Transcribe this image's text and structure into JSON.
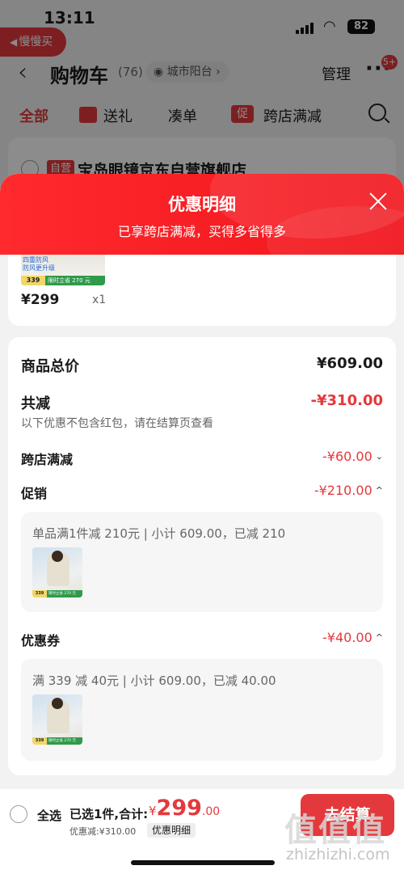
{
  "status_bar": {
    "time": "13:11",
    "battery": "82"
  },
  "back_app": {
    "label": "慢慢买"
  },
  "nav": {
    "title": "购物车",
    "count": "(76)",
    "location": "城市阳台",
    "manage": "管理",
    "more": "···",
    "badge": "5+"
  },
  "tabs": [
    {
      "label": "全部"
    },
    {
      "label": "送礼"
    },
    {
      "label": "凑单"
    },
    {
      "label": "跨店满减",
      "icon_text": "促"
    }
  ],
  "store": {
    "self_tag": "自营",
    "name": "宝岛眼镜京东自营旗舰店"
  },
  "sheet": {
    "title": "优惠明细",
    "subtitle": "已享跨店满减，买得多省得多"
  },
  "product": {
    "price": "¥299",
    "qty": "x1",
    "thumb_text1": "四重防风",
    "thumb_text2": "防风更升级",
    "thumb_price": "339",
    "thumb_tag": "限时立省 270 元"
  },
  "details": {
    "total_label": "商品总价",
    "total_value": "¥609.00",
    "reduce_label": "共减",
    "reduce_value": "-¥310.00",
    "reduce_note": "以下优惠不包含红包，请在结算页查看",
    "cross_label": "跨店满减",
    "cross_value": "-¥60.00",
    "promo_label": "促销",
    "promo_value": "-¥210.00",
    "promo_desc": "单品满1件减 210元 | 小计 609.00，已减 210",
    "coupon_label": "优惠券",
    "coupon_value": "-¥40.00",
    "coupon_desc": "满 339 减 40元 | 小计 609.00，已减 40.00",
    "mini_thumb_price": "339",
    "mini_thumb_tag": "限时立省 270 元"
  },
  "bottom_bar": {
    "select_all": "全选",
    "selected": "已选1件,合计:",
    "currency": "¥",
    "total_int": "299",
    "total_dec": ".00",
    "discount": "优惠减:¥310.00",
    "detail_button": "优惠明细",
    "checkout": "去结算"
  },
  "watermark": {
    "logo": "值值值",
    "url": "zhizhizhi.com"
  },
  "colors": {
    "accent": "#e4393c",
    "header_red": "#ff2a2e",
    "promo_green": "#2f9a4a"
  }
}
